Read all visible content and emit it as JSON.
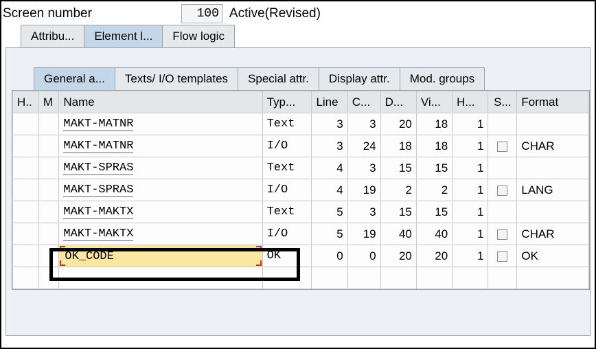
{
  "header": {
    "label": "Screen number",
    "value": "100",
    "status": "Active(Revised)"
  },
  "outer_tabs": [
    {
      "label": "Attribu...",
      "active": false
    },
    {
      "label": "Element l...",
      "active": true
    },
    {
      "label": "Flow logic",
      "active": false
    }
  ],
  "inner_tabs": [
    {
      "label": "General a...",
      "active": true
    },
    {
      "label": "Texts/ I/O templates",
      "active": false
    },
    {
      "label": "Special attr.",
      "active": false
    },
    {
      "label": "Display attr.",
      "active": false
    },
    {
      "label": "Mod. groups",
      "active": false
    }
  ],
  "columns": {
    "h": "H..",
    "m": "M",
    "name": "Name",
    "type": "Typ...",
    "line": "Line",
    "c": "C...",
    "d": "D...",
    "vi": "Vi...",
    "hh": "H...",
    "s": "S...",
    "format": "Format"
  },
  "rows": [
    {
      "name": "MAKT-MATNR",
      "type": "Text",
      "line": "3",
      "c": "3",
      "d": "20",
      "vi": "18",
      "h_": "1",
      "chk": false,
      "format": ""
    },
    {
      "name": "MAKT-MATNR",
      "type": "I/O",
      "line": "3",
      "c": "24",
      "d": "18",
      "vi": "18",
      "h_": "1",
      "chk": true,
      "format": "CHAR"
    },
    {
      "name": "MAKT-SPRAS",
      "type": "Text",
      "line": "4",
      "c": "3",
      "d": "15",
      "vi": "15",
      "h_": "1",
      "chk": false,
      "format": ""
    },
    {
      "name": "MAKT-SPRAS",
      "type": "I/O",
      "line": "4",
      "c": "19",
      "d": "2",
      "vi": "2",
      "h_": "1",
      "chk": true,
      "format": "LANG"
    },
    {
      "name": "MAKT-MAKTX",
      "type": "Text",
      "line": "5",
      "c": "3",
      "d": "15",
      "vi": "15",
      "h_": "1",
      "chk": false,
      "format": ""
    },
    {
      "name": "MAKT-MAKTX",
      "type": "I/O",
      "line": "5",
      "c": "19",
      "d": "40",
      "vi": "40",
      "h_": "1",
      "chk": true,
      "format": "CHAR"
    }
  ],
  "edit_row": {
    "name": "OK_CODE",
    "type": "OK",
    "line": "0",
    "c": "0",
    "d": "20",
    "vi": "20",
    "h_": "1",
    "chk": true,
    "format": " OK"
  }
}
